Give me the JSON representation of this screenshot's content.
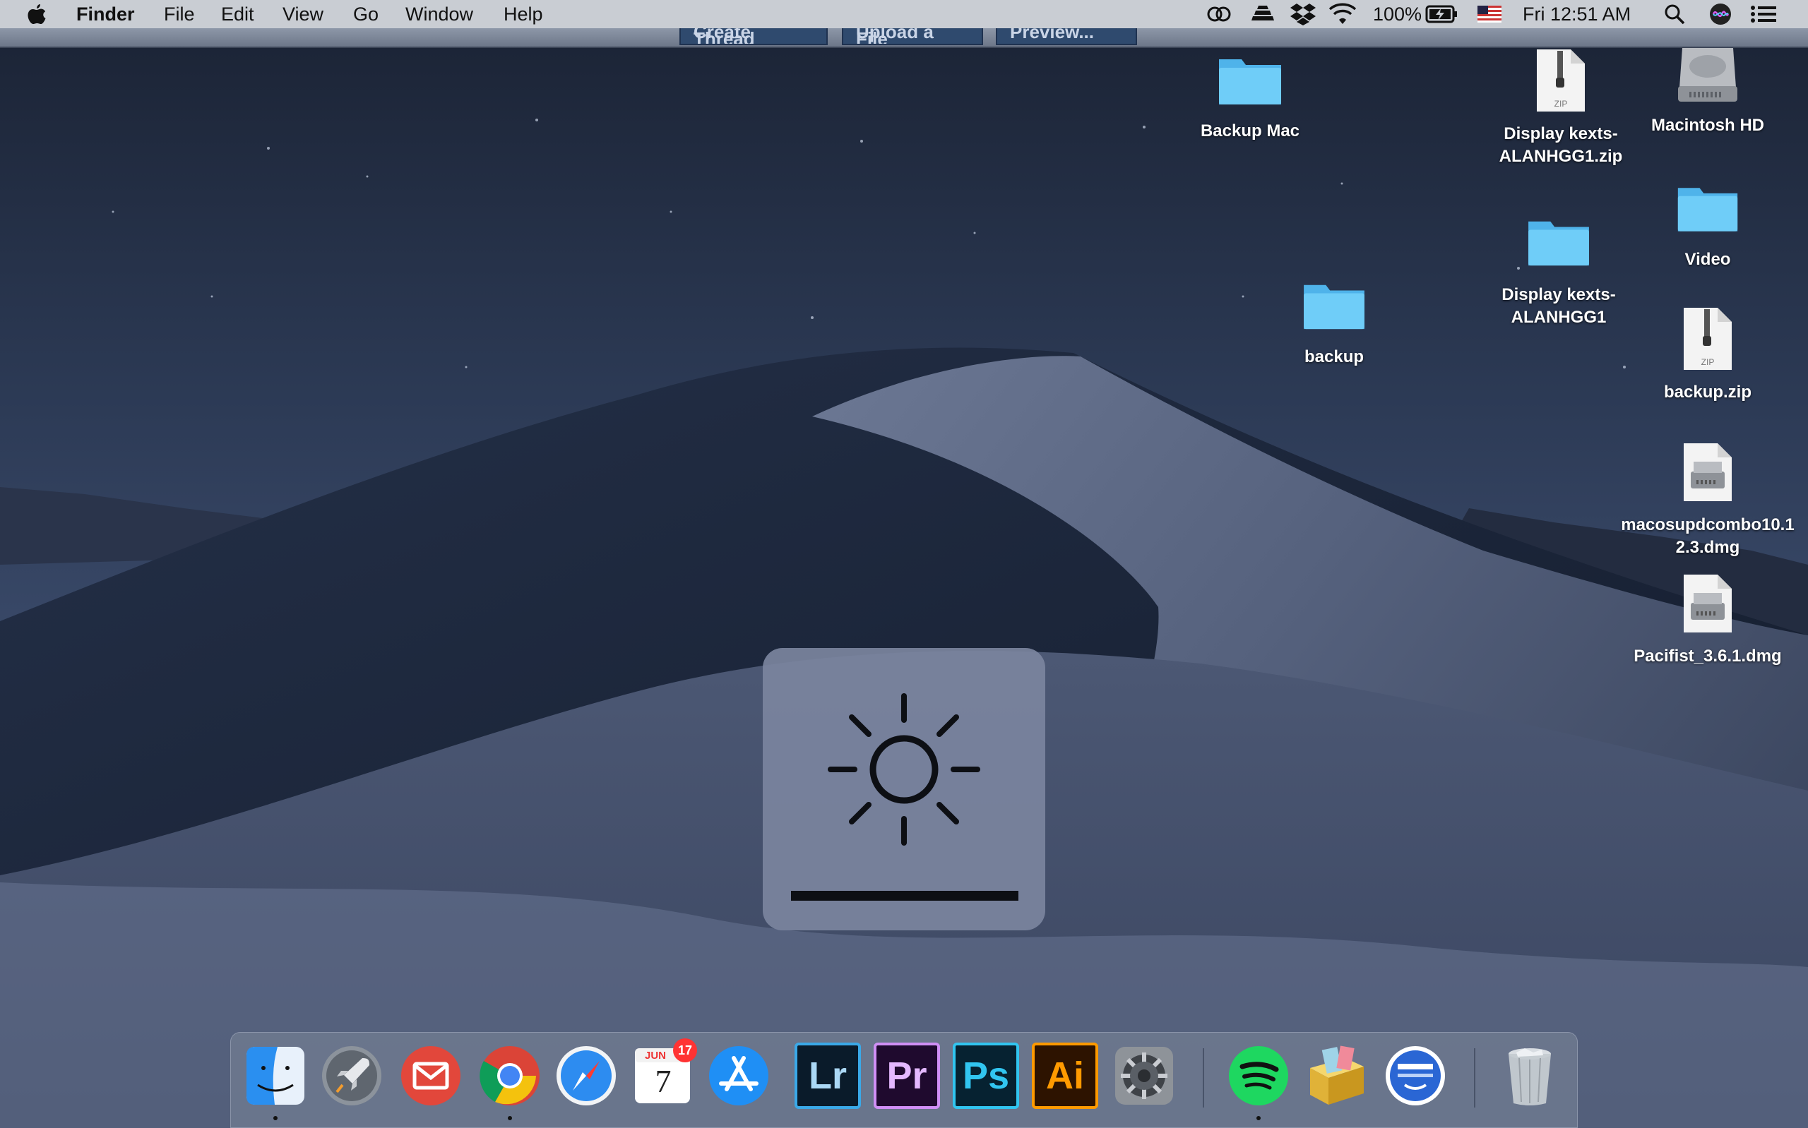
{
  "menubar": {
    "app_name": "Finder",
    "menus": [
      "File",
      "Edit",
      "View",
      "Go",
      "Window",
      "Help"
    ],
    "battery": "100%",
    "clock": "Fri 12:51 AM"
  },
  "window_buttons": [
    "Create Thread",
    "Upload a File",
    "Preview..."
  ],
  "desktop_icons": {
    "backup_mac": "Backup Mac",
    "display_zip_1": "Display kexts-",
    "display_zip_2": "ALANHGG1.zip",
    "macintosh_hd": "Macintosh HD",
    "video": "Video",
    "backup": "backup",
    "display_folder_1": "Display kexts-",
    "display_folder_2": "ALANHGG1",
    "backup_zip": "backup.zip",
    "macos_dmg_1": "macosupdcombo10.1",
    "macos_dmg_2": "2.3.dmg",
    "pacifist": "Pacifist_3.6.1.dmg",
    "zip_badge": "ZIP"
  },
  "hud": {
    "type": "brightness",
    "level": 1.0
  },
  "dock": {
    "apps": [
      "finder",
      "launchpad",
      "airmail",
      "chrome",
      "safari",
      "calendar",
      "app-store",
      "lightroom",
      "premiere",
      "photoshop",
      "illustrator",
      "system-preferences",
      "spotify",
      "archive-utility",
      "menu-app",
      "trash"
    ],
    "calendar_month": "JUN",
    "calendar_day": "7",
    "calendar_badge": "17",
    "lr_label": "Lr",
    "pr_label": "Pr",
    "ps_label": "Ps",
    "ai_label": "Ai"
  },
  "colors": {
    "folder": "#5ec4f5",
    "hud_bg": "#7b849e",
    "menubar_bg": "#c9cdd3"
  }
}
